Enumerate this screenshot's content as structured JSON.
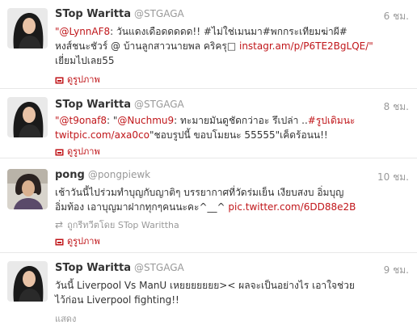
{
  "colors": {
    "link": "#c0161a",
    "muted": "#999999",
    "text": "#333333"
  },
  "tweets": [
    {
      "name": "STop Waritta",
      "handle": "@STGAGA",
      "time": "6 ชม.",
      "lines": [
        [
          {
            "t": "link",
            "v": "\"@LynnAF8"
          },
          {
            "t": "text",
            "v": ": วันแดงเดือดดดดด!! #ไม่ใช่เมนมา#พกกระเทียมฆ่าผี#"
          }
        ],
        [
          {
            "t": "text",
            "v": "หงส์ชนะชัวร์ @ บ้านลูกสาวนายพล คริครุ□ "
          },
          {
            "t": "link",
            "v": "instagr.am/p/P6TE2BgLQE/\""
          }
        ],
        [
          {
            "t": "text",
            "v": "เยี่ยมไปเลย55"
          }
        ]
      ],
      "action": "ดูรูปภาพ"
    },
    {
      "name": "STop Waritta",
      "handle": "@STGAGA",
      "time": "8 ชม.",
      "lines": [
        [
          {
            "t": "link",
            "v": "\"@t9onaf8"
          },
          {
            "t": "text",
            "v": ": \""
          },
          {
            "t": "link",
            "v": "@Nuchmu9"
          },
          {
            "t": "text",
            "v": ": ทะมายมันดูชัดกว่าอะ รึเปล่า .."
          },
          {
            "t": "link",
            "v": "#รูปเดิมนะ"
          }
        ],
        [
          {
            "t": "link",
            "v": "twitpic.com/axa0co"
          },
          {
            "t": "text",
            "v": "\"ชอบรูปนี้ ขอบโมยนะ 55555\"เค็ดร้อนน!!"
          }
        ]
      ],
      "action": "ดูรูปภาพ"
    },
    {
      "name": "pong",
      "handle": "@pongpiewk",
      "time": "10 ชม.",
      "lines": [
        [
          {
            "t": "text",
            "v": "เช้าวันนี้ไปร่วมทำบุญกับญาติๆ บรรยากาศที่วัดร่มเย็น เงียบสงบ อิ่มบุญ"
          }
        ],
        [
          {
            "t": "text",
            "v": "อิ่มท้อง เอาบุญมาฝากทุกๆคนนะคะ^__^ "
          },
          {
            "t": "link",
            "v": "pic.twitter.com/6DD88e2B"
          }
        ]
      ],
      "retweet": "ถูกรีทวีตโดย STop Warittha",
      "action": "ดูรูปภาพ"
    },
    {
      "name": "STop Waritta",
      "handle": "@STGAGA",
      "time": "9 ชม.",
      "lines": [
        [
          {
            "t": "text",
            "v": "วันนี้ Liverpool Vs ManU เหยยยยยยย>< ผลจะเป็นอย่างไร เอาใจช่วย"
          }
        ],
        [
          {
            "t": "text",
            "v": "ไว้ก่อน Liverpool fighting!!"
          }
        ]
      ],
      "show": "แสดง"
    }
  ]
}
